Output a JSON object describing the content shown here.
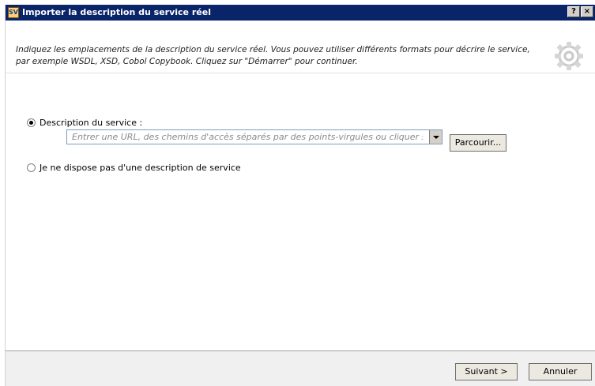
{
  "window": {
    "title": "Importer la description du service réel",
    "app_icon_text": "SV",
    "help_button": "?",
    "close_button": "×"
  },
  "header": {
    "description": "Indiquez les emplacements de la description du service réel. Vous pouvez utiliser différents formats pour décrire le service, par exemple WSDL, XSD, Cobol Copybook. Cliquez sur \"Démarrer\" pour continuer.",
    "icon": "gear-icon"
  },
  "options": {
    "service_description": {
      "label": "Description du service :",
      "selected": true
    },
    "no_description": {
      "label": "Je ne dispose pas d'une description de service",
      "selected": false
    }
  },
  "location_input": {
    "placeholder": "Entrer une URL, des chemins d'accès séparés par des points-virgules ou cliquer sur Parcourir",
    "value": ""
  },
  "buttons": {
    "browse": "Parcourir...",
    "next": "Suivant >",
    "cancel": "Annuler"
  },
  "colors": {
    "titlebar": "#0a246a",
    "footer": "#f0f0f0"
  }
}
